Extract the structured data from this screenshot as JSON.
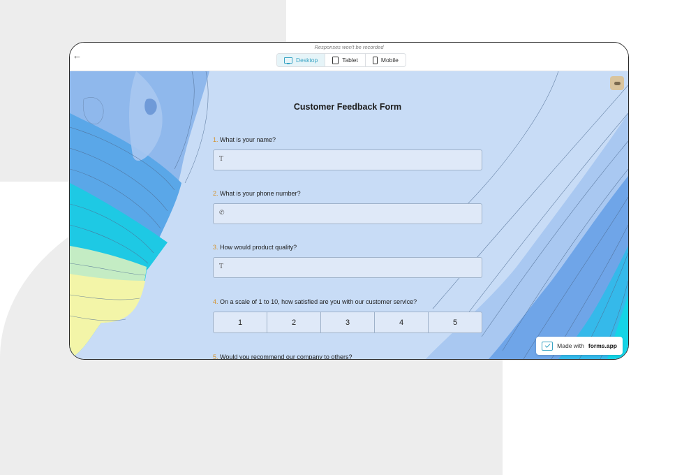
{
  "preview": {
    "notice": "Responses won't be recorded",
    "views": [
      {
        "label": "Desktop",
        "icon": "desktop-icon",
        "active": true
      },
      {
        "label": "Tablet",
        "icon": "tablet-icon",
        "active": false
      },
      {
        "label": "Mobile",
        "icon": "mobile-icon",
        "active": false
      }
    ]
  },
  "form": {
    "title": "Customer Feedback Form",
    "questions": [
      {
        "number": "1.",
        "text": "What is your name?",
        "icon": "T"
      },
      {
        "number": "2.",
        "text": "What is your phone number?",
        "icon": "✆"
      },
      {
        "number": "3.",
        "text": "How would product quality?",
        "icon": "T"
      },
      {
        "number": "4.",
        "text": "On a scale of 1 to 10, how satisfied are you with our customer service?",
        "options": [
          "1",
          "2",
          "3",
          "4",
          "5"
        ]
      },
      {
        "number": "5.",
        "text": "Would you recommend our company to others?"
      }
    ]
  },
  "badge": {
    "prefix": "Made with",
    "brand": "forms.app"
  },
  "colors": {
    "accent": "#3aa4c4",
    "question_number": "#d4922a",
    "canvas": "#c8dcf6"
  }
}
